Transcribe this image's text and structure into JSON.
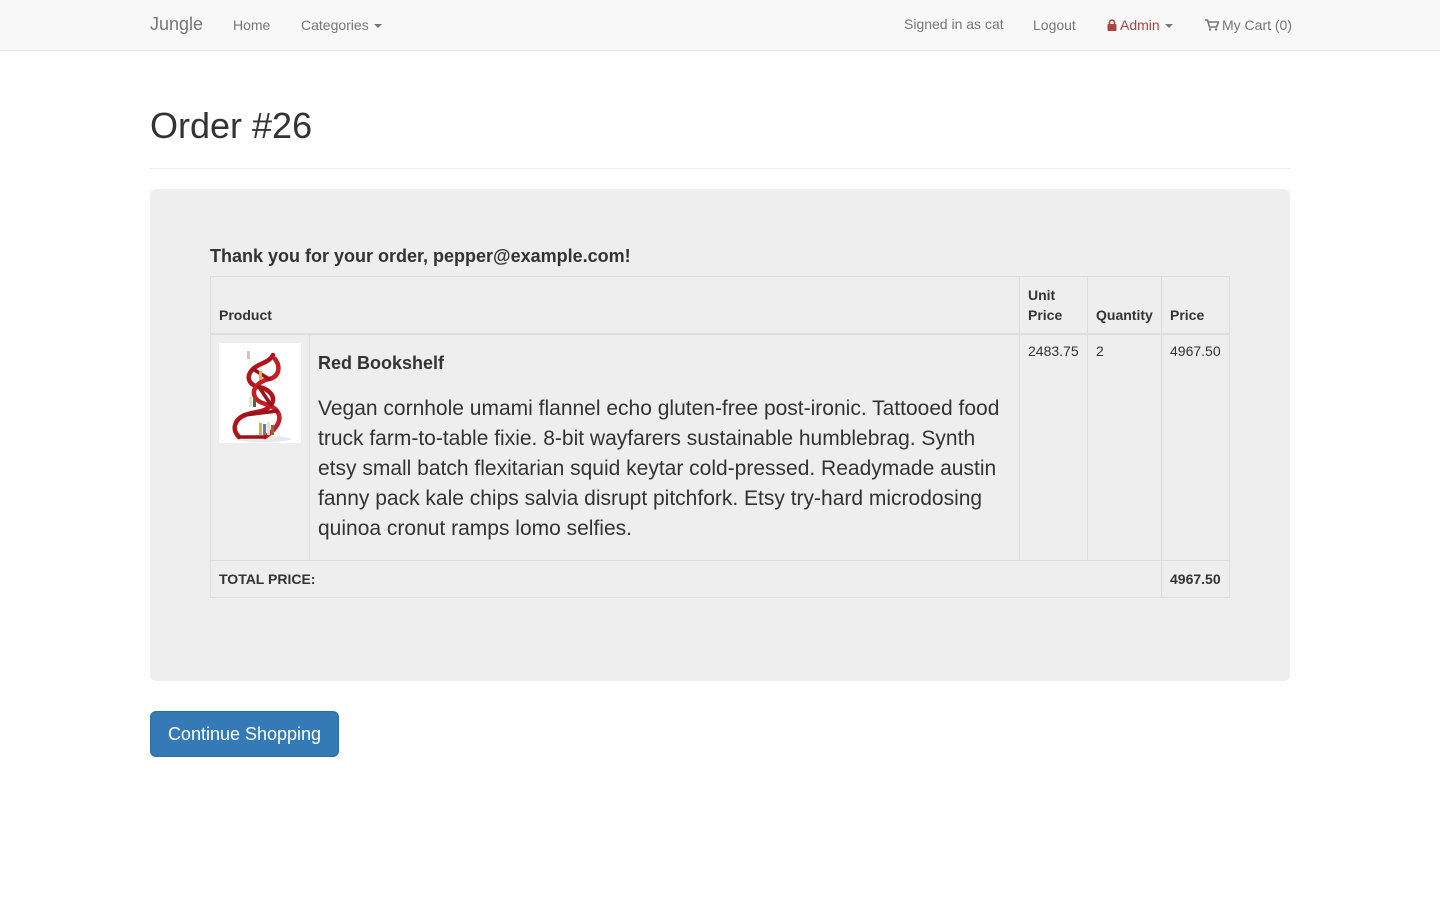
{
  "navbar": {
    "brand": "Jungle",
    "home": "Home",
    "categories": "Categories",
    "signed_in": "Signed in as cat",
    "logout": "Logout",
    "admin": "Admin",
    "cart": "My Cart (0)"
  },
  "page": {
    "title": "Order #26"
  },
  "order": {
    "thanks": "Thank you for your order, pepper@example.com!",
    "headers": {
      "product": "Product",
      "unit_price_line1": "Unit",
      "unit_price_line2": "Price",
      "quantity": "Quantity",
      "price": "Price"
    },
    "items": [
      {
        "name": "Red Bookshelf",
        "description": "Vegan cornhole umami flannel echo gluten-free post-ironic. Tattooed food truck farm-to-table fixie. 8-bit wayfarers sustainable humblebrag. Synth etsy small batch flexitarian squid keytar cold-pressed. Readymade austin fanny pack kale chips salvia disrupt pitchfork. Etsy try-hard microdosing quinoa cronut ramps lomo selfies.",
        "unit_price": "2483.75",
        "quantity": "2",
        "price": "4967.50"
      }
    ],
    "total_label": "TOTAL PRICE:",
    "total_value": "4967.50"
  },
  "actions": {
    "continue_shopping": "Continue Shopping"
  },
  "colors": {
    "navbar_bg": "#f8f8f8",
    "panel_bg": "#eeeeee",
    "primary": "#337ab7",
    "admin": "#a94442"
  }
}
